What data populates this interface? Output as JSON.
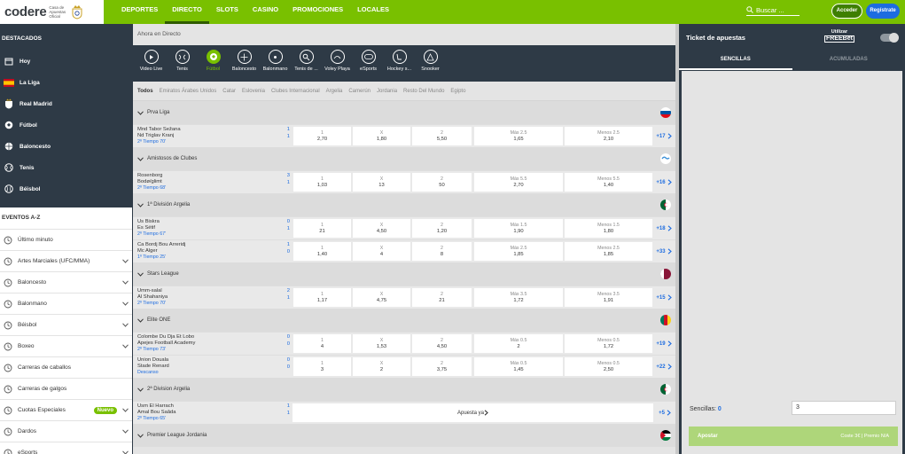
{
  "header": {
    "logo": "codere",
    "logo_sub": "Casa de Apuestas Oficial",
    "nav": [
      "DEPORTES",
      "DIRECTO",
      "SLOTS",
      "CASINO",
      "PROMOCIONES",
      "LOCALES"
    ],
    "active_nav": "DIRECTO",
    "search_placeholder": "Buscar ...",
    "login": "Acceder",
    "register": "Regístrate",
    "accent": "#79c000"
  },
  "sidebar": {
    "destacados_title": "DESTACADOS",
    "favorites": [
      {
        "label": "Hoy",
        "icon": "calendar-icon"
      },
      {
        "label": "La Liga",
        "icon": "spain-flag-icon"
      },
      {
        "label": "Real Madrid",
        "icon": "crest-icon"
      },
      {
        "label": "Fútbol",
        "icon": "football-icon"
      },
      {
        "label": "Baloncesto",
        "icon": "basketball-icon"
      },
      {
        "label": "Tenis",
        "icon": "tennis-icon"
      },
      {
        "label": "Béisbol",
        "icon": "baseball-icon"
      }
    ],
    "az_title": "EVENTOS A-Z",
    "az_items": [
      {
        "label": "Último minuto",
        "chev": false
      },
      {
        "label": "Artes Marciales (UFC/MMA)",
        "chev": true
      },
      {
        "label": "Baloncesto",
        "chev": true
      },
      {
        "label": "Balonmano",
        "chev": true
      },
      {
        "label": "Béisbol",
        "chev": true
      },
      {
        "label": "Boxeo",
        "chev": true
      },
      {
        "label": "Carreras de caballos",
        "chev": false
      },
      {
        "label": "Carreras de galgos",
        "chev": false
      },
      {
        "label": "Cuotas Especiales",
        "chev": true,
        "badge": "Nuevo"
      },
      {
        "label": "Dardos",
        "chev": true
      },
      {
        "label": "eSports",
        "chev": true
      }
    ]
  },
  "main": {
    "title": "Ahora en Directo",
    "sports": [
      "Video Live",
      "Tenis",
      "Fútbol",
      "Baloncesto",
      "Balonmano",
      "Tenis de ...",
      "Voley Playa",
      "eSports",
      "Hockey s...",
      "Snooker"
    ],
    "active_sport": "Fútbol",
    "countries": [
      "Todos",
      "Emiratos Árabes Unidos",
      "Catar",
      "Eslovenia",
      "Clubes Internacional",
      "Argelia",
      "Camerún",
      "Jordania",
      "Resto Del Mundo",
      "Egipto"
    ],
    "groups": [
      {
        "league": "Prva Liga",
        "flag": "slovenia",
        "matches": [
          {
            "home": "Mnd Tabor Sežana",
            "away": "Nd Triglav Kranj",
            "sh": "1",
            "sa": "1",
            "time": "2º Tiempo 70'",
            "o1": "2,70",
            "ox": "1,80",
            "o2": "5,50",
            "mas_l": "Más 2.5",
            "mas": "1,65",
            "men_l": "Menos 2.5",
            "men": "2,10",
            "more": "+17"
          }
        ]
      },
      {
        "league": "Amistosos de Clubes",
        "flag": "world",
        "matches": [
          {
            "home": "Rosenborg",
            "away": "Bodø/glimt",
            "sh": "3",
            "sa": "1",
            "time": "2º Tiempo 68'",
            "o1": "1,03",
            "ox": "13",
            "o2": "50",
            "mas_l": "Más 5.5",
            "mas": "2,70",
            "men_l": "Menos 5.5",
            "men": "1,40",
            "more": "+16"
          }
        ]
      },
      {
        "league": "1ª División Argelia",
        "flag": "algeria",
        "matches": [
          {
            "home": "Us Biskra",
            "away": "Es Sétif",
            "sh": "0",
            "sa": "1",
            "time": "2º Tiempo 67'",
            "o1": "21",
            "ox": "4,50",
            "o2": "1,20",
            "mas_l": "Más 1.5",
            "mas": "1,90",
            "men_l": "Menos 1.5",
            "men": "1,80",
            "more": "+18"
          },
          {
            "home": "Ca Bordj Bou Arreridj",
            "away": "Mc Alger",
            "sh": "1",
            "sa": "0",
            "time": "1º Tiempo 25'",
            "o1": "1,40",
            "ox": "4",
            "o2": "8",
            "mas_l": "Más 2.5",
            "mas": "1,85",
            "men_l": "Menos 2.5",
            "men": "1,85",
            "more": "+33"
          }
        ]
      },
      {
        "league": "Stars League",
        "flag": "qatar",
        "matches": [
          {
            "home": "Umm-salal",
            "away": "Al Shahaniya",
            "sh": "2",
            "sa": "1",
            "time": "2º Tiempo 70'",
            "o1": "1,17",
            "ox": "4,75",
            "o2": "21",
            "mas_l": "Más 3.5",
            "mas": "1,72",
            "men_l": "Menos 3.5",
            "men": "1,91",
            "more": "+15"
          }
        ]
      },
      {
        "league": "Elite ONE",
        "flag": "cameroon",
        "matches": [
          {
            "home": "Colombe Du Dja Et Lobo",
            "away": "Apejes Football Academy",
            "sh": "0",
            "sa": "0",
            "time": "2º Tiempo 73'",
            "o1": "4",
            "ox": "1,53",
            "o2": "4,50",
            "mas_l": "Más 0.5",
            "mas": "2",
            "men_l": "Menos 0.5",
            "men": "1,72",
            "more": "+19"
          },
          {
            "home": "Union Douala",
            "away": "Stade Renard",
            "sh": "0",
            "sa": "0",
            "time": "Descanso",
            "o1": "3",
            "ox": "2",
            "o2": "3,75",
            "mas_l": "Más 0.5",
            "mas": "1,45",
            "men_l": "Menos 0.5",
            "men": "2,50",
            "more": "+22"
          }
        ]
      },
      {
        "league": "2ª Division Argelia",
        "flag": "algeria",
        "matches": [
          {
            "home": "Usm El Harrach",
            "away": "Amal Bou Saâda",
            "sh": "1",
            "sa": "1",
            "time": "2º Tiempo 65'",
            "apuesta": "Apuesta ya",
            "more": "+5"
          }
        ]
      },
      {
        "league": "Premier League Jordania",
        "flag": "jordan",
        "matches": []
      }
    ]
  },
  "ticket": {
    "title": "Ticket de apuestas",
    "freebet_top": "Utilizar",
    "freebet": "FREEBet",
    "tabs": [
      "SENCILLAS",
      "ACUMULADAS"
    ],
    "sencillas_label": "Sencillas:",
    "sencillas_count": "0",
    "stake": "3",
    "bet_label": "Apostar",
    "coste": "Coste 3€",
    "premio": "Premio N/A"
  }
}
